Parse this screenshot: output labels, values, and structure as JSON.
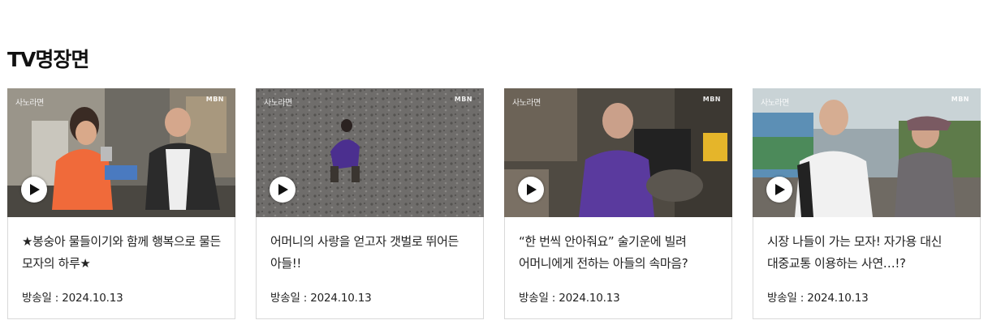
{
  "section": {
    "title": "TV명장면"
  },
  "cards": [
    {
      "title": "★봉숭아 물들이기와 함께 행복으로 물든 모자의 하루★",
      "date_label": "방송일 : 2024.10.13",
      "icon": "play-icon"
    },
    {
      "title": "어머니의 사랑을 얻고자 갯벌로 뛰어든 아들!!",
      "date_label": "방송일 : 2024.10.13",
      "icon": "play-icon"
    },
    {
      "title": "“한 번씩 안아줘요” 술기운에 빌려 어머니에게 전하는 아들의 속마음?",
      "date_label": "방송일 : 2024.10.13",
      "icon": "play-icon"
    },
    {
      "title": "시장 나들이 가는 모자! 자가용 대신 대중교통 이용하는 사연…!?",
      "date_label": "방송일 : 2024.10.13",
      "icon": "play-icon"
    }
  ],
  "colors": {
    "text": "#222222",
    "card_border": "#d9d9d9",
    "play_bg": "#ffffff"
  }
}
